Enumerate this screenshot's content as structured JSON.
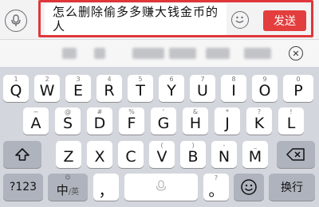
{
  "input_bar": {
    "message_text": "怎么删除偷多多赚大钱金币的人",
    "send_label": "发送"
  },
  "suggestion_bar": {
    "clear_symbol": "✕"
  },
  "keyboard": {
    "row1": [
      {
        "hint": "1",
        "label": "Q"
      },
      {
        "hint": "2",
        "label": "W"
      },
      {
        "hint": "3",
        "label": "E"
      },
      {
        "hint": "4",
        "label": "R"
      },
      {
        "hint": "5",
        "label": "T"
      },
      {
        "hint": "6",
        "label": "Y"
      },
      {
        "hint": "7",
        "label": "U"
      },
      {
        "hint": "8",
        "label": "I"
      },
      {
        "hint": "9",
        "label": "O"
      },
      {
        "hint": "0",
        "label": "P"
      }
    ],
    "row2": [
      {
        "hint": "~",
        "label": "A"
      },
      {
        "hint": "@",
        "label": "S"
      },
      {
        "hint": "#",
        "label": "D"
      },
      {
        "hint": "%",
        "label": "F"
      },
      {
        "hint": "'",
        "label": "G"
      },
      {
        "hint": "&",
        "label": "H"
      },
      {
        "hint": "*",
        "label": "J"
      },
      {
        "hint": "?",
        "label": "K"
      },
      {
        "hint": "!",
        "label": "L"
      }
    ],
    "row3": [
      {
        "hint": "",
        "label": "Z"
      },
      {
        "hint": "",
        "label": "X"
      },
      {
        "hint": "",
        "label": "C"
      },
      {
        "hint": "(",
        "label": "V"
      },
      {
        "hint": ")",
        "label": "B"
      },
      {
        "hint": "-",
        "label": "N"
      },
      {
        "hint": "_",
        "label": "M"
      }
    ],
    "numbers_label": "?123",
    "lang_label_main": "中",
    "lang_label_alt": "/英",
    "lang_hint": "☺",
    "comma_label": "，",
    "comma_hint": "",
    "period_label": "。",
    "period_hint": "?",
    "return_label": "换行"
  }
}
